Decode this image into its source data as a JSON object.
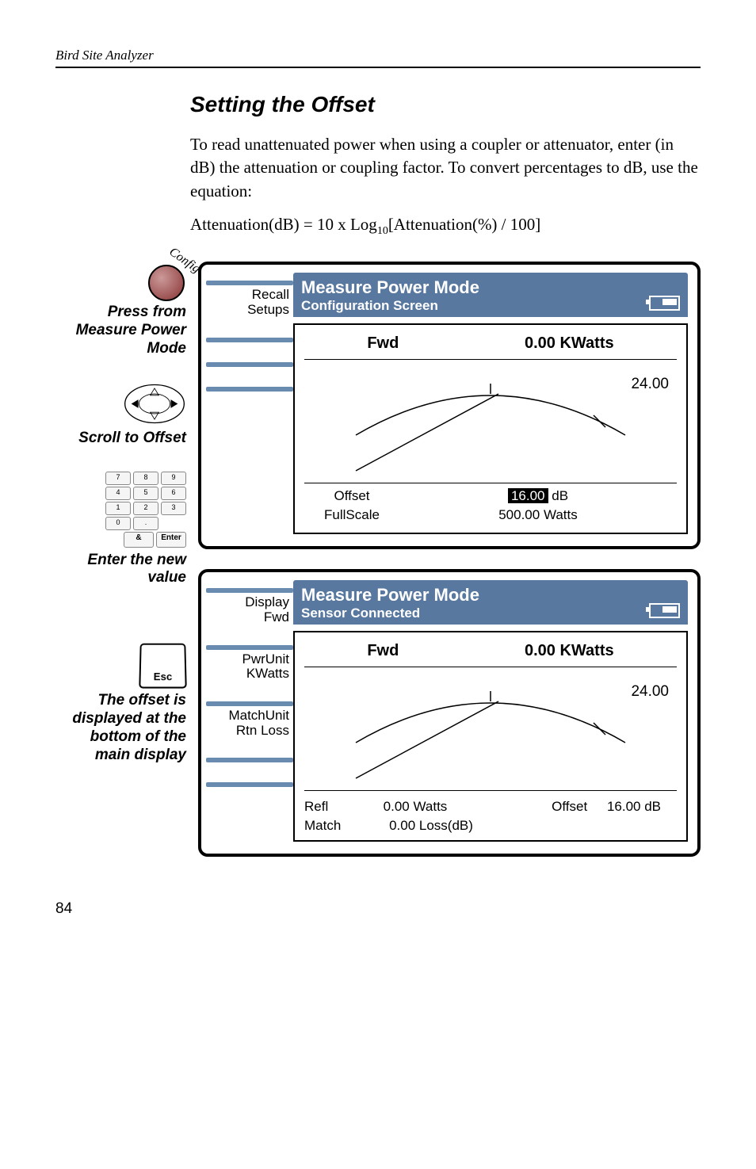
{
  "header": "Bird Site Analyzer",
  "title": "Setting the Offset",
  "para": "To read unattenuated power when using a coupler or attenuator, enter (in dB) the attenuation or coupling factor. To convert percentages to dB, use the equation:",
  "formula_pre": "Attenuation(dB) = 10 x Log",
  "formula_sub": "10",
  "formula_post": "[Attenuation(%) / 100]",
  "config_label": "Config",
  "step1": "Press from Measure Power Mode",
  "step2": "Scroll to Offset",
  "step3": "Enter the new value",
  "step4": "The offset is displayed at the bottom of the main display",
  "keypad": {
    "r1": [
      "7",
      "8",
      "9"
    ],
    "r2": [
      "4",
      "5",
      "6"
    ],
    "r3": [
      "1",
      "2",
      "3"
    ],
    "r4": [
      "0",
      "."
    ],
    "amp": "&",
    "enter": "Enter"
  },
  "esc": "Esc",
  "screen1": {
    "title": "Measure Power Mode",
    "subtitle": "Configuration Screen",
    "softkeys": [
      {
        "l1": "Recall",
        "l2": "Setups"
      },
      {
        "l1": "",
        "l2": ""
      },
      {
        "l1": "",
        "l2": ""
      },
      {
        "l1": "",
        "l2": ""
      }
    ],
    "fwd_label": "Fwd",
    "fwd_value": "0.00 KWatts",
    "meter_value": "24.00",
    "offset_label": "Offset",
    "offset_value": "16.00",
    "offset_unit": "dB",
    "fullscale_label": "FullScale",
    "fullscale_value": "500.00 Watts"
  },
  "screen2": {
    "title": "Measure Power Mode",
    "subtitle": "Sensor Connected",
    "softkeys": [
      {
        "l1": "Display",
        "l2": "Fwd"
      },
      {
        "l1": "PwrUnit",
        "l2": "KWatts"
      },
      {
        "l1": "MatchUnit",
        "l2": "Rtn Loss"
      },
      {
        "l1": "",
        "l2": ""
      },
      {
        "l1": "",
        "l2": ""
      }
    ],
    "fwd_label": "Fwd",
    "fwd_value": "0.00 KWatts",
    "meter_value": "24.00",
    "refl_label": "Refl",
    "refl_value": "0.00 Watts",
    "offset_label": "Offset",
    "offset_value": "16.00 dB",
    "match_label": "Match",
    "match_value": "0.00 Loss(dB)"
  },
  "chart_data": [
    {
      "type": "gauge",
      "title": "Measure Power Mode - Configuration Screen",
      "fwd": 0.0,
      "fwd_unit": "KWatts",
      "needle_value": 24.0,
      "offset_db": 16.0,
      "fullscale_watts": 500.0
    },
    {
      "type": "gauge",
      "title": "Measure Power Mode - Sensor Connected",
      "fwd": 0.0,
      "fwd_unit": "KWatts",
      "needle_value": 24.0,
      "refl_watts": 0.0,
      "offset_db": 16.0,
      "match_loss_db": 0.0
    }
  ],
  "page_num": "84"
}
